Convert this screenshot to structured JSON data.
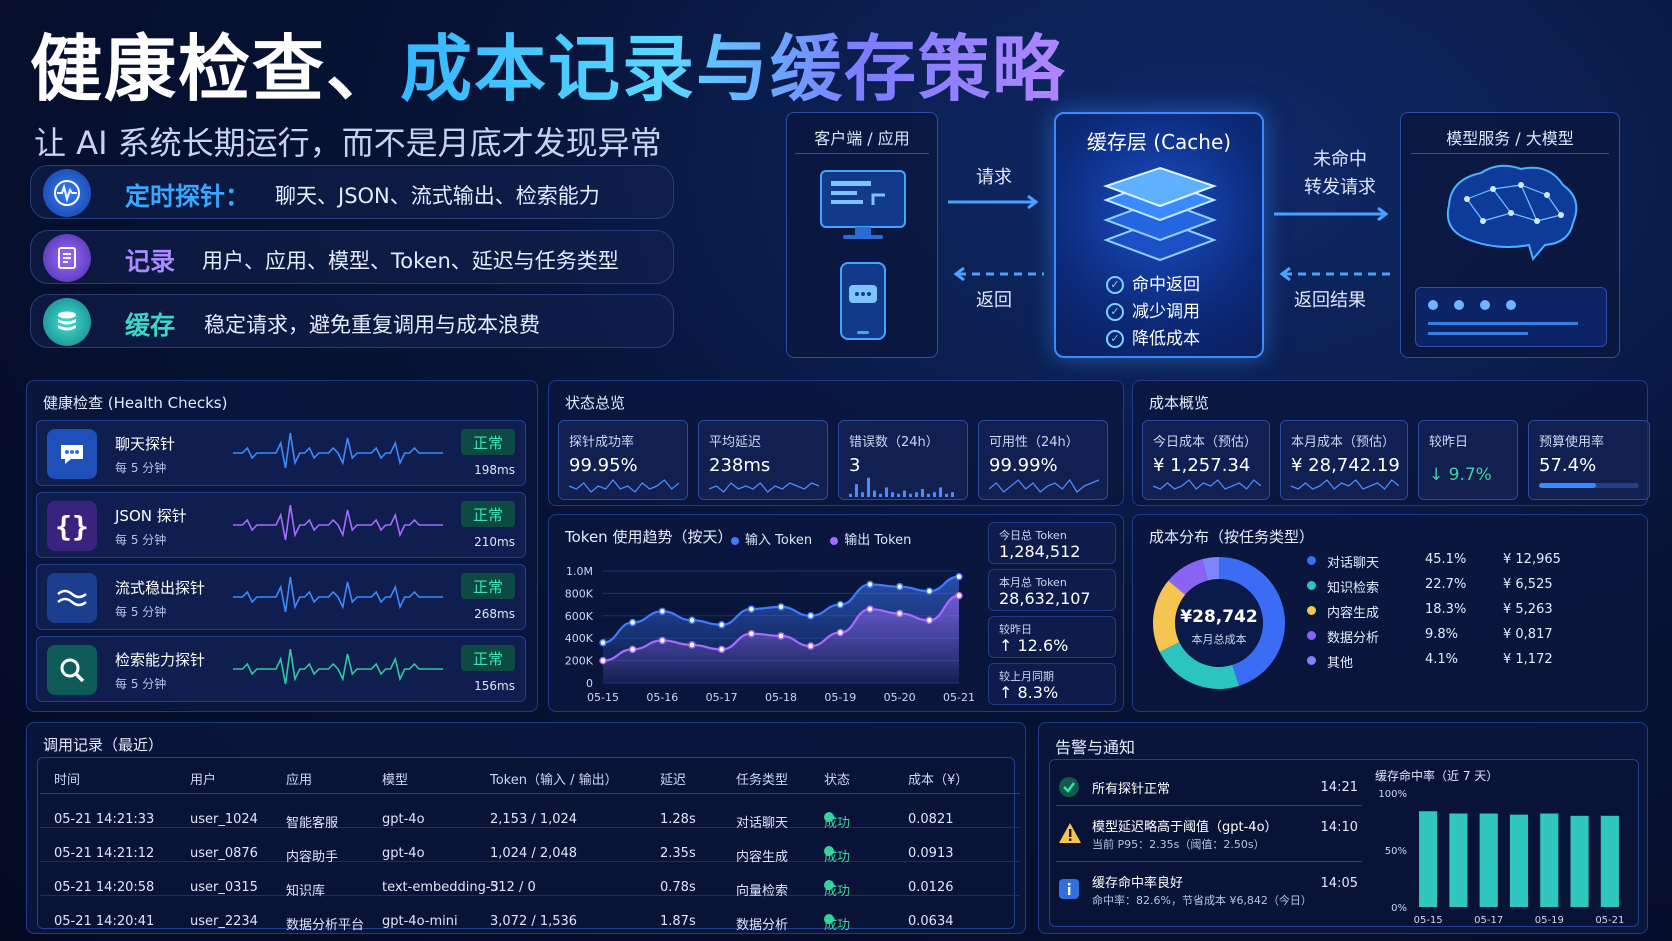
{
  "header": {
    "title_part1": "健康检查、",
    "title_part2": "成本记录与缓存策略",
    "subtitle": "让 AI 系统长期运行，而不是月底才发现异常"
  },
  "features": [
    {
      "key": "定时探针：",
      "text": "聊天、JSON、流式输出、检索能力",
      "icon": "pulse-icon",
      "color": "#3a9bff"
    },
    {
      "key": "记录",
      "text": "用户、应用、模型、Token、延迟与任务类型",
      "icon": "document-icon",
      "color": "#9a7bff"
    },
    {
      "key": "缓存",
      "text": "稳定请求，避免重复调用与成本浪费",
      "icon": "database-icon",
      "color": "#3fd4c6"
    }
  ],
  "flow": {
    "client_title": "客户端 / 应用",
    "request_label": "请求",
    "return_label": "返回",
    "cache_title": "缓存层 (Cache)",
    "cache_points": [
      "命中返回",
      "减少调用",
      "降低成本"
    ],
    "miss_label_1": "未命中",
    "miss_label_2": "转发请求",
    "result_label": "返回结果",
    "model_title": "模型服务 / 大模型"
  },
  "health": {
    "title": "健康检查 (Health Checks)",
    "probes": [
      {
        "name": "聊天探针",
        "interval": "每 5 分钟",
        "status": "正常",
        "latency": "198ms",
        "icon": "chat-icon",
        "color": "#3a8bff"
      },
      {
        "name": "JSON 探针",
        "interval": "每 5 分钟",
        "status": "正常",
        "latency": "210ms",
        "icon": "braces-icon",
        "color": "#a66bff"
      },
      {
        "name": "流式稳出探针",
        "interval": "每 5 分钟",
        "status": "正常",
        "latency": "268ms",
        "icon": "wave-icon",
        "color": "#3a8bff"
      },
      {
        "name": "检索能力探针",
        "interval": "每 5 分钟",
        "status": "正常",
        "latency": "156ms",
        "icon": "search-icon",
        "color": "#2fc9a4"
      }
    ]
  },
  "status": {
    "title": "状态总览",
    "cards": [
      {
        "label": "探针成功率",
        "value": "99.95%"
      },
      {
        "label": "平均延迟",
        "value": "238ms"
      },
      {
        "label": "错误数（24h）",
        "value": "3"
      },
      {
        "label": "可用性（24h）",
        "value": "99.99%"
      }
    ]
  },
  "token": {
    "title": "Token 使用趋势（按天）",
    "legend_in": "输入 Token",
    "legend_out": "输出 Token",
    "stats": [
      {
        "label": "今日总 Token",
        "value": "1,284,512"
      },
      {
        "label": "本月总 Token",
        "value": "28,632,107"
      },
      {
        "label": "较昨日",
        "value": "↑ 12.6%"
      },
      {
        "label": "较上月同期",
        "value": "↑ 8.3%"
      }
    ]
  },
  "cost": {
    "title": "成本概览",
    "cards": [
      {
        "label": "今日成本（预估）",
        "value": "¥ 1,257.34"
      },
      {
        "label": "本月成本（预估）",
        "value": "¥ 28,742.19"
      },
      {
        "label": "较昨日",
        "value": "↓ 9.7%"
      },
      {
        "label": "预算使用率",
        "value": "57.4%"
      }
    ],
    "budget_fraction": 0.574
  },
  "distribution": {
    "title": "成本分布（按任务类型）",
    "center_value": "¥28,742",
    "center_label": "本月总成本",
    "items": [
      {
        "name": "对话聊天",
        "pct": "45.1%",
        "amount": "¥ 12,965",
        "share": 45.1,
        "color": "#3b6cf6"
      },
      {
        "name": "知识检索",
        "pct": "22.7%",
        "amount": "¥ 6,525",
        "share": 22.7,
        "color": "#2bc5c0"
      },
      {
        "name": "内容生成",
        "pct": "18.3%",
        "amount": "¥ 5,263",
        "share": 18.3,
        "color": "#f5c451"
      },
      {
        "name": "数据分析",
        "pct": "9.8%",
        "amount": "¥ 0,817",
        "share": 9.8,
        "color": "#8a63f5"
      },
      {
        "name": "其他",
        "pct": "4.1%",
        "amount": "¥ 1,172",
        "share": 4.1,
        "color": "#7d86f8"
      }
    ]
  },
  "calls": {
    "title": "调用记录（最近）",
    "columns": [
      "时间",
      "用户",
      "应用",
      "模型",
      "Token（输入 / 输出）",
      "延迟",
      "任务类型",
      "状态",
      "成本（¥）"
    ],
    "rows": [
      [
        "05-21 14:21:33",
        "user_1024",
        "智能客服",
        "gpt-4o",
        "2,153 / 1,024",
        "1.28s",
        "对话聊天",
        "成功",
        "0.0821"
      ],
      [
        "05-21 14:21:12",
        "user_0876",
        "内容助手",
        "gpt-4o",
        "1,024 / 2,048",
        "2.35s",
        "内容生成",
        "成功",
        "0.0913"
      ],
      [
        "05-21 14:20:58",
        "user_0315",
        "知识库",
        "text-embedding-3",
        "512 / 0",
        "0.78s",
        "向量检索",
        "成功",
        "0.0126"
      ],
      [
        "05-21 14:20:41",
        "user_2234",
        "数据分析平台",
        "gpt-4o-mini",
        "3,072 / 1,536",
        "1.87s",
        "数据分析",
        "成功",
        "0.0634"
      ]
    ]
  },
  "alerts": {
    "title": "告警与通知",
    "items": [
      {
        "title": "所有探针正常",
        "time": "14:21",
        "detail": "",
        "icon": "check-icon"
      },
      {
        "title": "模型延迟略高于阈值（gpt-4o）",
        "time": "14:10",
        "detail": "当前 P95：2.35s（阈值：2.50s）",
        "icon": "warning-icon"
      },
      {
        "title": "缓存命中率良好",
        "time": "14:05",
        "detail": "命中率：82.6%，节省成本 ¥6,842（今日）",
        "icon": "info-icon"
      }
    ]
  },
  "chart_data": [
    {
      "type": "area",
      "title": "Token 使用趋势（按天）",
      "x": [
        "05-15",
        "05-16",
        "05-17",
        "05-18",
        "05-19",
        "05-20",
        "05-21"
      ],
      "y_ticks": [
        "0",
        "200K",
        "400K",
        "600K",
        "800K",
        "1.0M"
      ],
      "ylim": [
        0,
        1000000
      ],
      "series": [
        {
          "name": "输入 Token",
          "color": "#3d7bff",
          "x": [
            "05-15",
            "05-15.5",
            "05-16",
            "05-16.5",
            "05-17",
            "05-17.5",
            "05-18",
            "05-18.5",
            "05-19",
            "05-19.5",
            "05-20",
            "05-20.5",
            "05-21"
          ],
          "values": [
            360000,
            540000,
            640000,
            560000,
            520000,
            660000,
            680000,
            600000,
            700000,
            880000,
            860000,
            820000,
            950000
          ]
        },
        {
          "name": "输出 Token",
          "color": "#a86bff",
          "x": [
            "05-15",
            "05-15.5",
            "05-16",
            "05-16.5",
            "05-17",
            "05-17.5",
            "05-18",
            "05-18.5",
            "05-19",
            "05-19.5",
            "05-20",
            "05-20.5",
            "05-21"
          ],
          "values": [
            200000,
            300000,
            380000,
            340000,
            300000,
            440000,
            420000,
            330000,
            450000,
            660000,
            620000,
            560000,
            780000
          ]
        }
      ]
    },
    {
      "type": "pie",
      "title": "成本分布（按任务类型）",
      "categories": [
        "对话聊天",
        "知识检索",
        "内容生成",
        "数据分析",
        "其他"
      ],
      "values": [
        45.1,
        22.7,
        18.3,
        9.8,
        4.1
      ]
    },
    {
      "type": "bar",
      "title": "缓存命中率（近 7 天）",
      "categories": [
        "05-15",
        "05-16",
        "05-17",
        "05-18",
        "05-19",
        "05-20",
        "05-21"
      ],
      "x_tick_labels": [
        "05-15",
        "05-17",
        "05-19",
        "05-21"
      ],
      "values": [
        84,
        82,
        82,
        81,
        82,
        80,
        80
      ],
      "y_ticks": [
        "0%",
        "50%",
        "100%"
      ],
      "ylim": [
        0,
        100
      ]
    }
  ]
}
